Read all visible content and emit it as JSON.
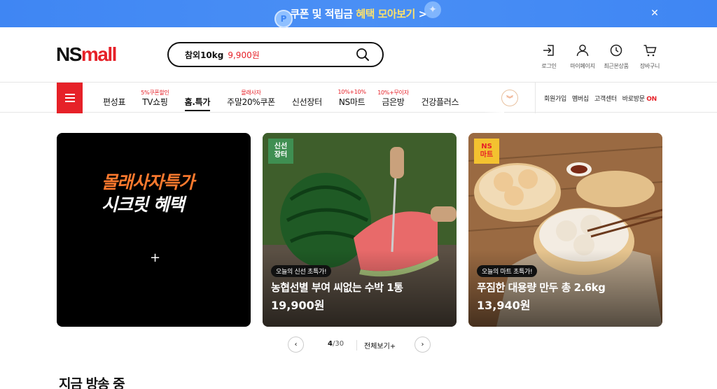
{
  "promo": {
    "text_main": "쿠폰 및 적립금 ",
    "text_highlight": "혜택 모아보기",
    "arrow": ">",
    "coin_glyph": "P",
    "close_glyph": "✕"
  },
  "header": {
    "logo_ns": "NS",
    "logo_mall": "mall",
    "search": {
      "keyword": "참외10kg",
      "price": "9,900원"
    },
    "utils": [
      {
        "label": "로그인",
        "icon": "login-icon"
      },
      {
        "label": "마이페이지",
        "icon": "user-icon"
      },
      {
        "label": "최근본상품",
        "icon": "clock-icon"
      },
      {
        "label": "장바구니",
        "icon": "cart-icon"
      }
    ]
  },
  "nav": {
    "items": [
      {
        "sub": "",
        "label": "편성표"
      },
      {
        "sub": "5%쿠폰할인",
        "label": "TV쇼핑"
      },
      {
        "sub": "",
        "label": "홈.특가"
      },
      {
        "sub": "몰래사자",
        "label": "주말20%쿠폰"
      },
      {
        "sub": "",
        "label": "신선장터"
      },
      {
        "sub": "10%+10%",
        "label": "NS마트"
      },
      {
        "sub": "10%+무이자",
        "label": "금은방"
      },
      {
        "sub": "",
        "label": "건강플러스"
      }
    ],
    "active_index": 2,
    "right": {
      "join": "회원가입",
      "membership": "멤버십",
      "service": "고객센터",
      "visit": "바로방문",
      "visit_state": "ON"
    }
  },
  "cards": [
    {
      "title_l1": "몰래사자특가",
      "title_l2": "시크릿 혜택",
      "plus": "+"
    },
    {
      "badge_l1": "신선",
      "badge_l2": "장터",
      "tag": "오늘의 신선 초특가!",
      "name": "농협선별 부여 씨없는 수박 1통",
      "price": "19,900원"
    },
    {
      "badge_l1": "NS",
      "badge_l2": "마트",
      "tag": "오늘의 마트 초특가!",
      "name": "푸짐한 대용량 만두 총 2.6kg",
      "price": "13,940원"
    }
  ],
  "carousel": {
    "current": "4",
    "total": "/30",
    "view_all": "전체보기+",
    "prev": "‹",
    "next": "›"
  },
  "section_title": "지금 방송 중",
  "colors": {
    "brand_red": "#e62128",
    "promo_blue": "#3f86f3",
    "highlight_yellow": "#ffe26a"
  }
}
